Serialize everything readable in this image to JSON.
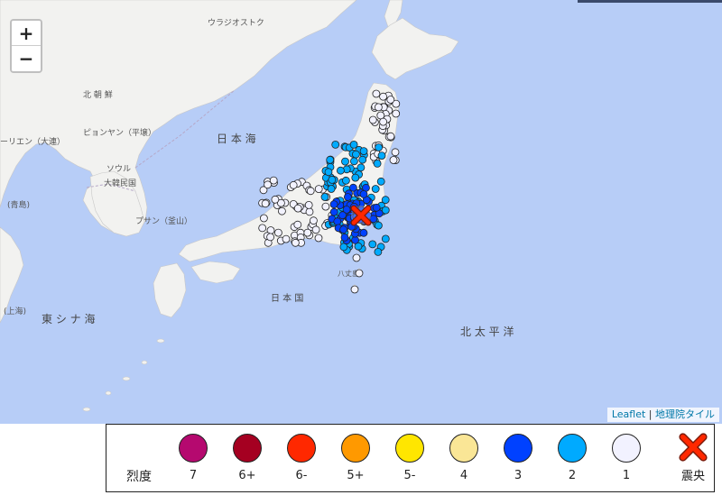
{
  "map": {
    "sea_color": "#b7cdf7",
    "land_color": "#f2f2f0",
    "labels": {
      "vladivostok": "ウラジオストク",
      "north_korea": "北 朝 鮮",
      "pyongyang": "ピョンヤン（平壌）",
      "liaoning": "ーリエン（大連）",
      "seoul": "ソウル",
      "south_korea": "大韓民国",
      "busan": "プサン（釜山）",
      "qingdao": "(青島)",
      "shanghai": "(上海)",
      "japan_sea": "日 本 海",
      "east_china_sea": "東 シ ナ 海",
      "pacific": "北 太 平 洋",
      "japan_country": "日 本 国",
      "hachijo": "八丈島"
    },
    "epicenter_icon": "epicenter-x-icon"
  },
  "zoom": {
    "in": "+",
    "out": "−"
  },
  "attribution": {
    "leaflet": "Leaflet",
    "separator": "|",
    "tiles": "地理院タイル"
  },
  "legend": {
    "title": "烈度",
    "items": [
      {
        "label": "7",
        "color": "#b5096f"
      },
      {
        "label": "6+",
        "color": "#a50021"
      },
      {
        "label": "6-",
        "color": "#ff2800"
      },
      {
        "label": "5+",
        "color": "#ff9900"
      },
      {
        "label": "5-",
        "color": "#ffe600"
      },
      {
        "label": "4",
        "color": "#fae696"
      },
      {
        "label": "3",
        "color": "#0041ff"
      },
      {
        "label": "2",
        "color": "#00aaff"
      },
      {
        "label": "1",
        "color": "#f2f2ff"
      }
    ],
    "epicenter_label": "震央",
    "epicenter_color": "#ff2800"
  }
}
